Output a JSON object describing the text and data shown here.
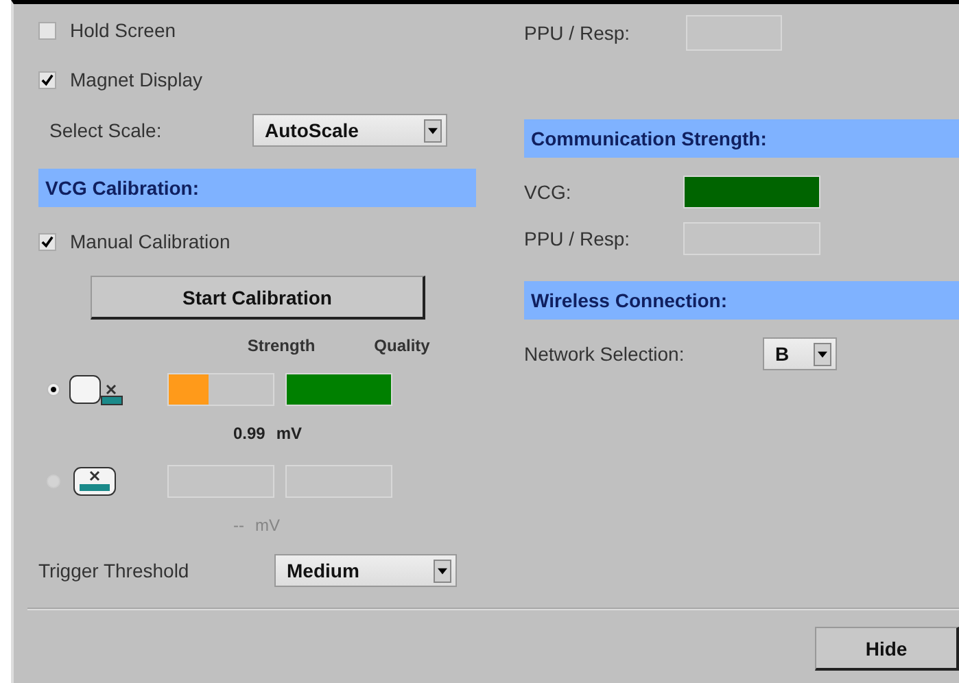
{
  "hold_screen": {
    "label": "Hold Screen",
    "checked": false
  },
  "magnet_display": {
    "label": "Magnet Display",
    "checked": true
  },
  "select_scale": {
    "label": "Select Scale:",
    "value": "AutoScale"
  },
  "vcg_calibration": {
    "title": "VCG Calibration:",
    "manual_calibration": {
      "label": "Manual Calibration",
      "checked": true
    },
    "start_button": "Start Calibration",
    "columns": [
      "Strength",
      "Quality"
    ],
    "sensors": [
      {
        "selected": true,
        "disabled": false,
        "strength": {
          "level": 0.38,
          "color": "#ff9a1a"
        },
        "quality": {
          "level": 1,
          "color": "#008000"
        },
        "value": "0.99",
        "unit": "mV"
      },
      {
        "selected": false,
        "disabled": true,
        "value": "--",
        "unit": "mV"
      }
    ]
  },
  "trigger_threshold": {
    "label": "Trigger Threshold",
    "value": "Medium"
  },
  "top_ppu_resp": {
    "label": "PPU / Resp:"
  },
  "communication_strength": {
    "title": "Communication Strength:",
    "rows": [
      {
        "label": "VCG:",
        "level": 1,
        "color": "#006400"
      },
      {
        "label": "PPU / Resp:"
      }
    ]
  },
  "wireless_connection": {
    "title": "Wireless Connection:",
    "network_label": "Network Selection:",
    "network_value": "B"
  },
  "hide_button": "Hide"
}
